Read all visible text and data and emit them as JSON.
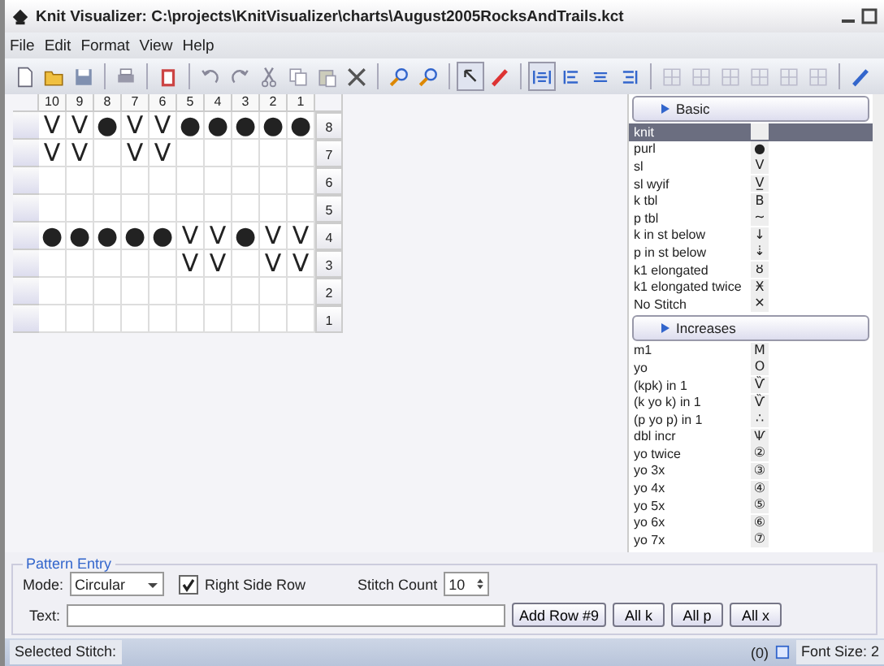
{
  "window": {
    "title": "Knit Visualizer: C:\\projects\\KnitVisualizer\\charts\\August2005RocksAndTrails.kct"
  },
  "menu": [
    "File",
    "Edit",
    "Format",
    "View",
    "Help"
  ],
  "toolbar": [
    [
      {
        "pressed": false
      },
      {
        "pressed": false
      },
      {
        "pressed": false
      }
    ],
    [
      {
        "pressed": false
      }
    ],
    [
      {
        "pressed": false
      }
    ],
    [
      {
        "pressed": false
      },
      {
        "pressed": false
      },
      {
        "pressed": false
      },
      {
        "pressed": false
      },
      {
        "pressed": false
      },
      {
        "pressed": false
      }
    ],
    [
      {
        "pressed": false
      },
      {
        "pressed": false
      }
    ],
    [
      {
        "pressed": true
      },
      {
        "pressed": false
      }
    ],
    [
      {
        "pressed": true
      },
      {
        "pressed": false
      },
      {
        "pressed": false
      },
      {
        "pressed": false
      }
    ],
    [
      {
        "pressed": false
      },
      {
        "pressed": false
      },
      {
        "pressed": false
      },
      {
        "pressed": false
      },
      {
        "pressed": false
      },
      {
        "pressed": false
      }
    ],
    [
      {
        "pressed": false
      }
    ]
  ],
  "chart": {
    "columns": [
      "10",
      "9",
      "8",
      "7",
      "6",
      "5",
      "4",
      "3",
      "2",
      "1"
    ],
    "rows": [
      {
        "label": "8",
        "cells": [
          "V",
          "V",
          "●",
          "V",
          "V",
          "●",
          "●",
          "●",
          "●",
          "●"
        ]
      },
      {
        "label": "7",
        "cells": [
          "V",
          "V",
          "",
          "V",
          "V",
          "",
          "",
          "",
          "",
          ""
        ]
      },
      {
        "label": "6",
        "cells": [
          "",
          "",
          "",
          "",
          "",
          "",
          "",
          "",
          "",
          ""
        ]
      },
      {
        "label": "5",
        "cells": [
          "",
          "",
          "",
          "",
          "",
          "",
          "",
          "",
          "",
          ""
        ]
      },
      {
        "label": "4",
        "cells": [
          "●",
          "●",
          "●",
          "●",
          "●",
          "V",
          "V",
          "●",
          "V",
          "V"
        ]
      },
      {
        "label": "3",
        "cells": [
          "",
          "",
          "",
          "",
          "",
          "V",
          "V",
          "",
          "V",
          "V"
        ]
      },
      {
        "label": "2",
        "cells": [
          "",
          "",
          "",
          "",
          "",
          "",
          "",
          "",
          "",
          ""
        ]
      },
      {
        "label": "1",
        "cells": [
          "",
          "",
          "",
          "",
          "",
          "",
          "",
          "",
          "",
          ""
        ]
      }
    ]
  },
  "palette": [
    {
      "title": "Basic",
      "items": [
        {
          "name": "knit",
          "selected": true
        },
        {
          "name": "purl",
          "symbol": "●",
          "selected": false
        },
        {
          "name": "sl",
          "symbol": "V",
          "selected": false
        },
        {
          "name": "sl wyif",
          "symbol": "V̲",
          "selected": false
        },
        {
          "name": "k tbl",
          "symbol": "B",
          "selected": false
        },
        {
          "name": "p tbl",
          "symbol": "~",
          "selected": false
        },
        {
          "name": "k in st below",
          "symbol": "↓",
          "selected": false
        },
        {
          "name": "p in st below",
          "symbol": "⇣",
          "selected": false
        },
        {
          "name": "k1 elongated",
          "symbol": "ȣ",
          "selected": false
        },
        {
          "name": "k1 elongated twice",
          "symbol": "Ӿ",
          "selected": false
        },
        {
          "name": "No Stitch",
          "symbol": "✕",
          "selected": false
        }
      ]
    },
    {
      "title": "Increases",
      "items": [
        {
          "name": "m1",
          "symbol": "M",
          "selected": false
        },
        {
          "name": "yo",
          "symbol": "O",
          "selected": false
        },
        {
          "name": "(kpk) in 1",
          "symbol": "Ѷ",
          "selected": false
        },
        {
          "name": "(k yo k) in 1",
          "symbol": "Ѷ",
          "selected": false
        },
        {
          "name": "(p yo p) in 1",
          "symbol": "∴",
          "selected": false
        },
        {
          "name": "dbl incr",
          "symbol": "Ѱ",
          "selected": false
        },
        {
          "name": "yo twice",
          "symbol": "②",
          "selected": false
        },
        {
          "name": "yo 3x",
          "symbol": "③",
          "selected": false
        },
        {
          "name": "yo 4x",
          "symbol": "④",
          "selected": false
        },
        {
          "name": "yo 5x",
          "symbol": "⑤",
          "selected": false
        },
        {
          "name": "yo 6x",
          "symbol": "⑥",
          "selected": false
        },
        {
          "name": "yo 7x",
          "symbol": "⑦",
          "selected": false
        }
      ]
    }
  ],
  "pattern_entry": {
    "title": "Pattern Entry",
    "mode_label": "Mode:",
    "mode": "Circular",
    "right_side_row": {
      "label": "Right Side Row",
      "checked": true
    },
    "stitch_count_label": "Stitch Count",
    "stitch_count": "10",
    "text_label": "Text:",
    "buttons": [
      "Add Row #9",
      "All k",
      "All p",
      "All x"
    ]
  },
  "status_bar": {
    "selected_stitch": "Selected Stitch:",
    "count": "(0)",
    "font_size": "Font Size: 2"
  }
}
